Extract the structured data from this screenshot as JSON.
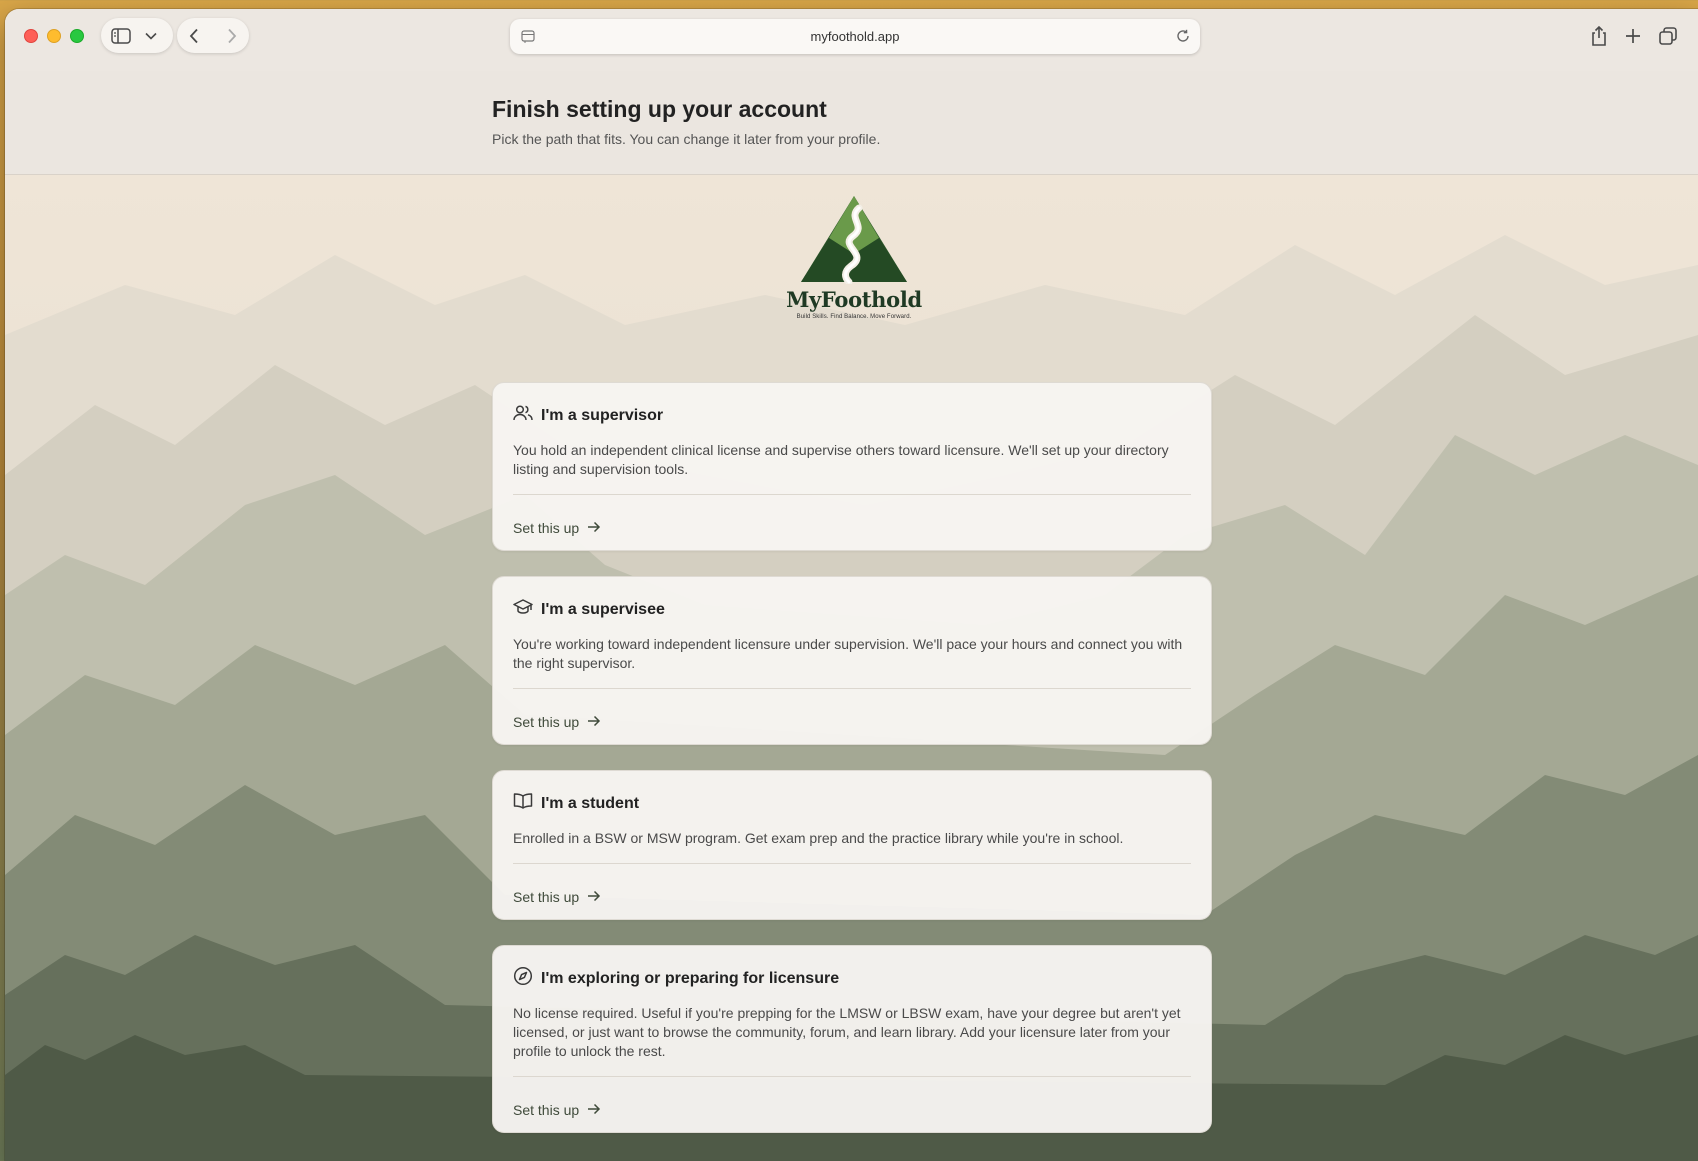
{
  "browser": {
    "url": "myfoothold.app"
  },
  "header": {
    "title": "Finish setting up your account",
    "subtitle": "Pick the path that fits. You can change it later from your profile."
  },
  "logo": {
    "name": "MyFoothold",
    "tagline": "Build Skills. Find Balance. Move Forward."
  },
  "cards": [
    {
      "icon": "users-icon",
      "title": "I'm a supervisor",
      "description": "You hold an independent clinical license and supervise others toward licensure. We'll set up your directory listing and supervision tools.",
      "cta": "Set this up"
    },
    {
      "icon": "graduation-cap-icon",
      "title": "I'm a supervisee",
      "description": "You're working toward independent licensure under supervision. We'll pace your hours and connect you with the right supervisor.",
      "cta": "Set this up"
    },
    {
      "icon": "open-book-icon",
      "title": "I'm a student",
      "description": "Enrolled in a BSW or MSW program. Get exam prep and the practice library while you're in school.",
      "cta": "Set this up"
    },
    {
      "icon": "compass-icon",
      "title": "I'm exploring or preparing for licensure",
      "description": "No license required. Useful if you're prepping for the LMSW or LBSW exam, have your degree but aren't yet licensed, or just want to browse the community, forum, and learn library. Add your licensure later from your profile to unlock the rest.",
      "cta": "Set this up"
    }
  ],
  "colors": {
    "accent": "#3f4a3a",
    "logo_green": "#2f5a2c"
  }
}
